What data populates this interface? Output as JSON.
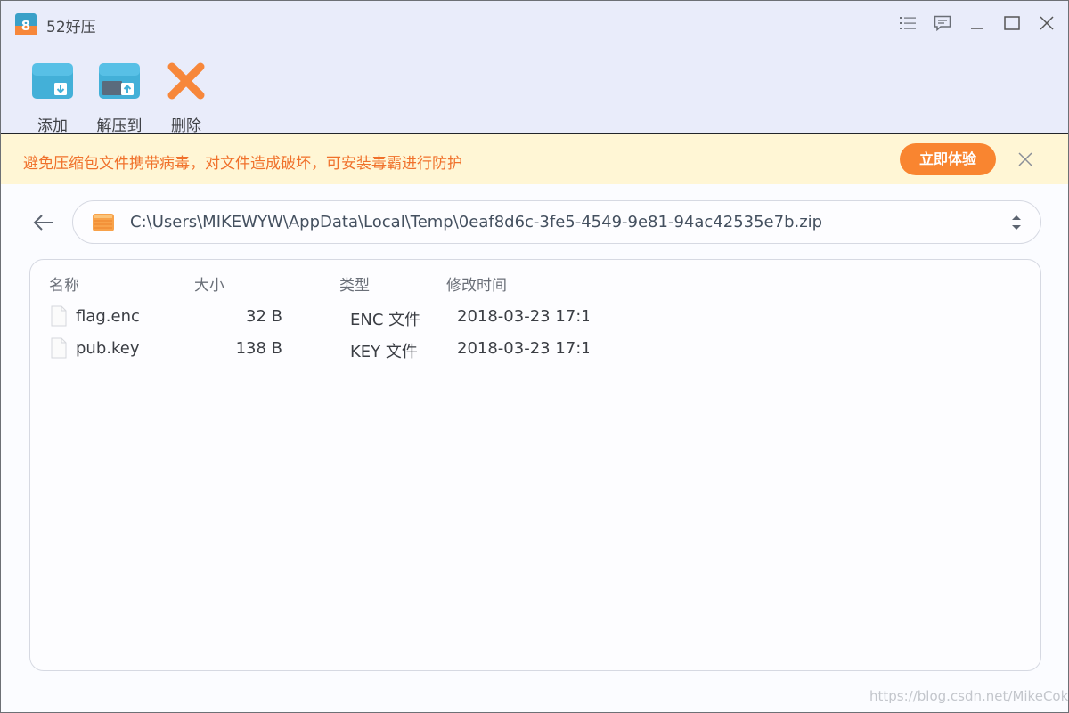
{
  "app": {
    "title": "52好压",
    "logo_text": "8"
  },
  "window_controls": [
    "menu-icon",
    "feedback-icon",
    "minimize-icon",
    "maximize-icon",
    "close-icon"
  ],
  "toolbar": {
    "add_label": "添加",
    "extract_label": "解压到",
    "delete_label": "删除"
  },
  "banner": {
    "text": "避免压缩包文件携带病毒，对文件造成破坏，可安装毒霸进行防护",
    "button_label": "立即体验"
  },
  "path": {
    "value": "C:\\Users\\MIKEWYW\\AppData\\Local\\Temp\\0eaf8d6c-3fe5-4549-9e81-94ac42535e7b.zip"
  },
  "table": {
    "columns": {
      "name": "名称",
      "size": "大小",
      "type": "类型",
      "modified": "修改时间"
    },
    "rows": [
      {
        "name": "flag.enc",
        "size": "32 B",
        "type": "ENC 文件",
        "modified": "2018-03-23 17:1"
      },
      {
        "name": "pub.key",
        "size": "138 B",
        "type": "KEY 文件",
        "modified": "2018-03-23 17:1"
      }
    ]
  },
  "watermark": "https://blog.csdn.net/MikeCoke",
  "colors": {
    "accent_orange": "#f98530",
    "banner_text": "#f0712b",
    "banner_bg": "#fff6d5",
    "toolbar_bg": "#e9ecfa",
    "icon_blue": "#43b0d8"
  }
}
